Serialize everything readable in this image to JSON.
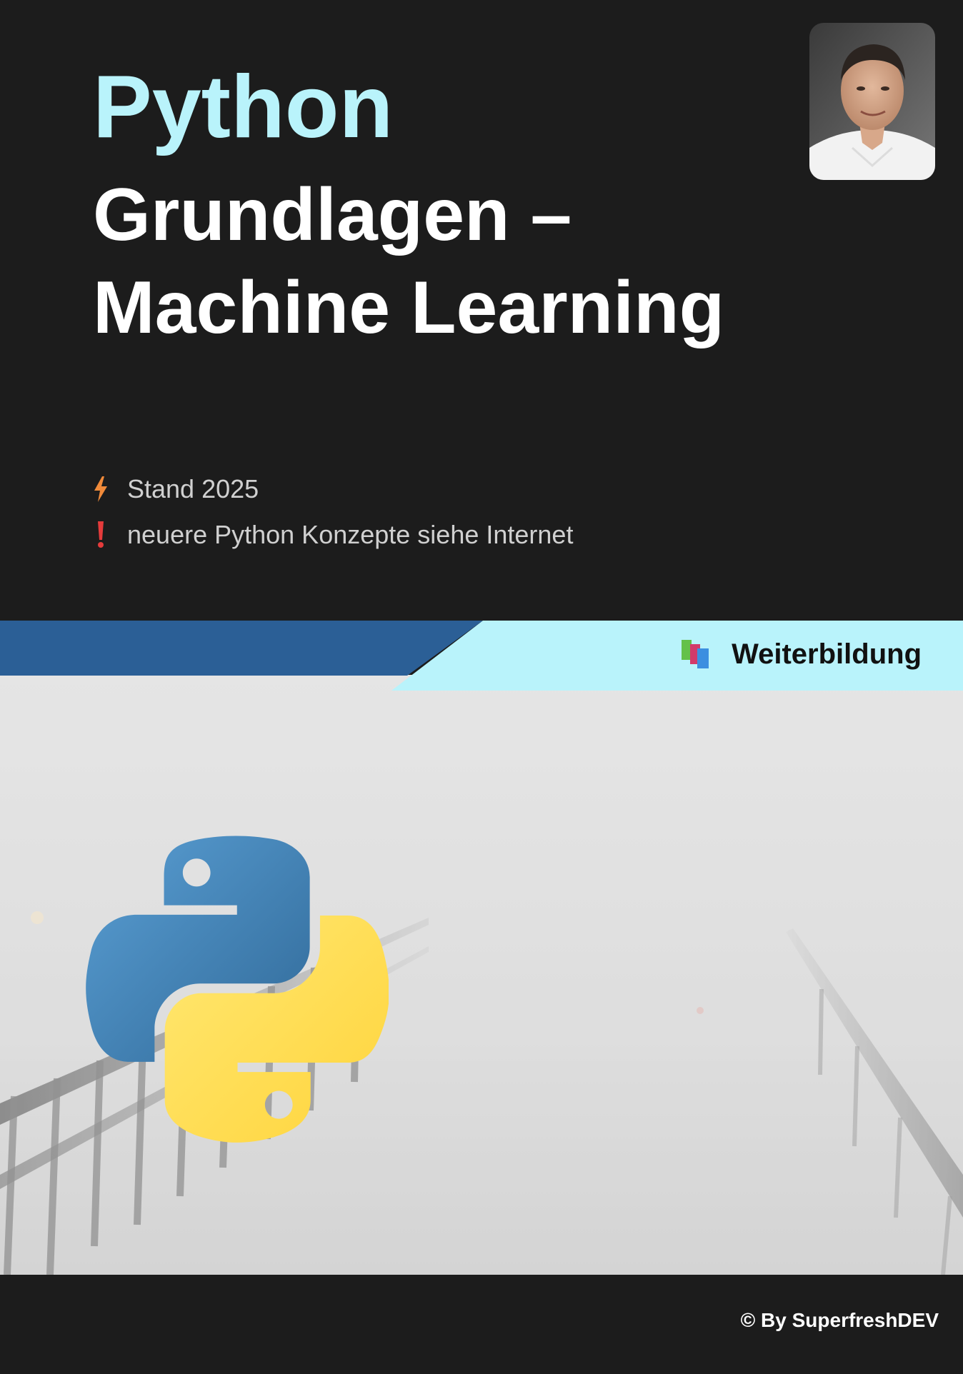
{
  "title": {
    "line1": "Python",
    "line2": "Grundlagen –",
    "line3": "Machine Learning"
  },
  "info": [
    {
      "icon": "lightning-icon",
      "text": "Stand 2025"
    },
    {
      "icon": "exclamation-icon",
      "text": "neuere Python Konzepte siehe Internet"
    }
  ],
  "badge": {
    "icon": "books-icon",
    "label": "Weiterbildung"
  },
  "footer": {
    "copyright": "© By SuperfreshDEV"
  },
  "colors": {
    "background": "#1c1c1c",
    "accent_cyan": "#b9f3fb",
    "band_blue": "#2b5f96",
    "python_blue": "#3e79b0",
    "python_yellow": "#ffd84a"
  }
}
